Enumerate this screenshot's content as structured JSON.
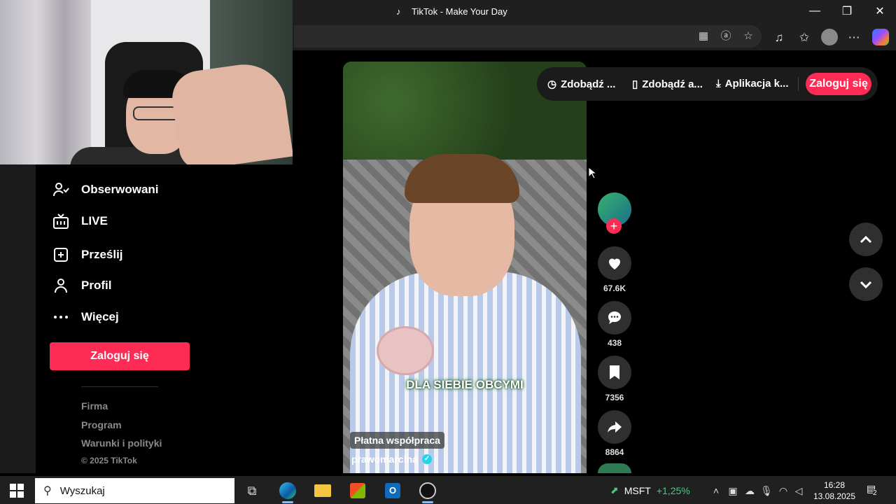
{
  "window": {
    "title": "TikTok - Make Your Day",
    "controls": {
      "minimize": "—",
      "restore": "❐",
      "close": "✕"
    }
  },
  "sidebar": {
    "items": [
      {
        "label": "Obserwowani",
        "icon": "following-icon"
      },
      {
        "label": "LIVE",
        "icon": "live-icon"
      },
      {
        "label": "Prześlij",
        "icon": "upload-icon"
      },
      {
        "label": "Profil",
        "icon": "profile-icon"
      },
      {
        "label": "Więcej",
        "icon": "more-icon"
      }
    ],
    "login_label": "Zaloguj się",
    "footer": [
      "Firma",
      "Program",
      "Warunki i polityki"
    ],
    "copyright": "© 2025 TikTok"
  },
  "topbar": {
    "items": [
      {
        "label": "Zdobądź ...",
        "icon": "coins-icon"
      },
      {
        "label": "Zdobądź a...",
        "icon": "phone-icon"
      },
      {
        "label": "Aplikacja k...",
        "icon": "download-icon"
      }
    ],
    "login_label": "Zaloguj się"
  },
  "video": {
    "caption": "DLA SIEBIE OBCYMI",
    "paid_label": "Płatna współpraca",
    "author": "prawomarcina"
  },
  "actions": {
    "likes": "67.6K",
    "comments": "438",
    "saves": "7356",
    "shares": "8864"
  },
  "taskbar": {
    "search_placeholder": "Wyszukaj",
    "stock_symbol": "MSFT",
    "stock_change": "+1,25%",
    "time": "16:28",
    "date": "13.08.2025",
    "notifications": "2"
  },
  "colors": {
    "accent": "#fe2c55",
    "background": "#000000",
    "panel": "#1b1b1b",
    "taskbar": "#202020",
    "stock_up": "#3fcf7a"
  }
}
